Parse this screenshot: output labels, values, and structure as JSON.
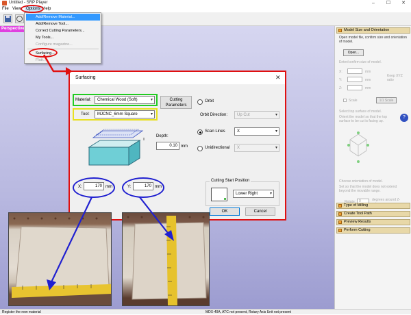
{
  "window": {
    "title": "Untitled - SRP Player"
  },
  "menubar": {
    "file": "File",
    "view": "View",
    "options": "Options",
    "help": "Help"
  },
  "viewport": {
    "tab_label": "Perspective"
  },
  "options_menu": {
    "items": [
      {
        "label": "Add/Remove Material...",
        "state": "highlighted"
      },
      {
        "label": "Add/Remove Tool...",
        "state": "normal"
      },
      {
        "label": "Correct Cutting Parameters...",
        "state": "normal"
      },
      {
        "label": "My Tools...",
        "state": "normal"
      },
      {
        "label": "Configure magazine...",
        "state": "disabled"
      },
      {
        "label": "Surfacing...",
        "state": "circled"
      },
      {
        "label": "Flatt...",
        "state": "disabled"
      }
    ]
  },
  "dialog": {
    "title": "Surfacing",
    "material_label": "Material:",
    "material_value": "Chemical Wood (Soft)",
    "tool_label": "Tool:",
    "tool_value": "MJCNC_6mm Square",
    "cutting_params_button": "Cutting Parameters",
    "orbit_label": "Orbit",
    "orbit_direction_label": "Orbit Direction:",
    "orbit_direction_value": "Up Cut",
    "scan_lines_label": "Scan Lines",
    "scan_lines_value": "X",
    "unidirectional_label": "Unidirectional",
    "unidirectional_value": "X",
    "depth_label": "Depth:",
    "depth_value": "0.10",
    "depth_unit": "mm",
    "x_label": "X:",
    "x_value": "170",
    "x_unit": "mm",
    "y_label": "Y:",
    "y_value": "170",
    "y_unit": "mm",
    "cutting_start_label": "Cutting Start Position",
    "cutting_start_value": "Lower Right",
    "ok_button": "OK",
    "cancel_button": "Cancel",
    "selected_mode": "scan_lines"
  },
  "right_panel": {
    "section1_title": "Model Size and Orientation",
    "open_text": "Open model file, confirm size and orientation of model.",
    "open_button": "Open...",
    "enter_text": "Enter/confirm size of model.",
    "x_label": "X:",
    "y_label": "Y:",
    "z_label": "Z:",
    "mm_unit": "mm",
    "keep_ratio": "Keep XYZ ratio",
    "scale_label": "Scale",
    "scale_button": "1/1 Scale",
    "select_face_text": "Select top surface of model.",
    "orient_text": "Orient the model so that the top surface to be cut is facing up.",
    "choose_text": "Choose orientation of model.",
    "rotate_text": "Set so that the model does not extend beyond the movable range.",
    "rotate_label": "Rotate:",
    "rotate_value": "0",
    "rotate_unit": "degrees around Z-axis",
    "sections": [
      "Type of Milling",
      "Create Tool Path",
      "Preview Results",
      "Perform Cutting"
    ]
  },
  "statusbar": {
    "left": "Register the new material",
    "right": "MDX-40A, ATC not present, Rotary Axis Unit not present"
  },
  "colors": {
    "highlight_red": "#e01010",
    "highlight_green": "#22cc22",
    "highlight_yellow": "#e8e020",
    "highlight_blue": "#2020d0",
    "menu_select": "#3399ff",
    "viewport_tab": "#e040e0"
  }
}
